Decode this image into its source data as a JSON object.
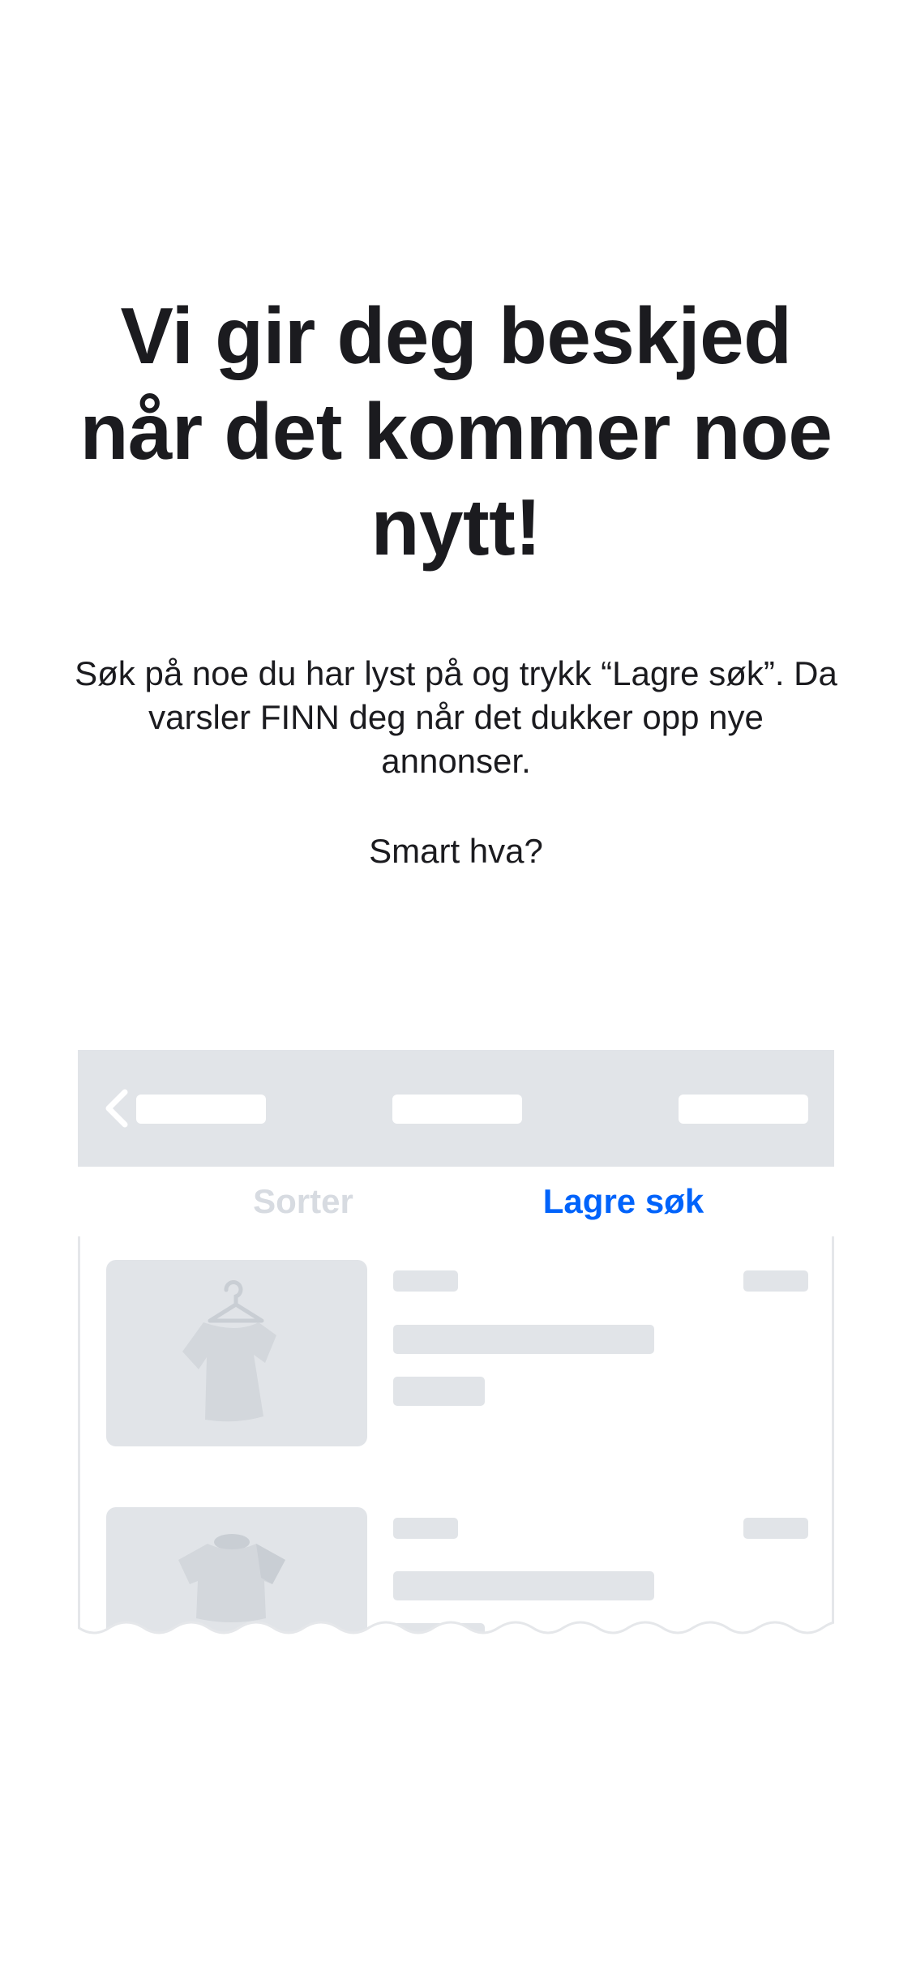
{
  "headline": "Vi gir deg beskjed når det kommer noe nytt!",
  "body": {
    "line": "Søk på noe du har lyst på og trykk “Lagre søk”. Da varsler FINN deg når det dukker opp nye annonser.",
    "tagline": "Smart hva?"
  },
  "illustration": {
    "tabs": {
      "sort_label": "Sorter",
      "save_search_label": "Lagre søk"
    },
    "icons": [
      "back-chevron-icon",
      "hanger-shirt-icon",
      "tshirt-icon"
    ],
    "colors": {
      "accent": "#0063fb",
      "placeholder": "#e1e4e8",
      "inactive_tab": "#d7dbe1",
      "text": "#1b1b1f"
    }
  }
}
